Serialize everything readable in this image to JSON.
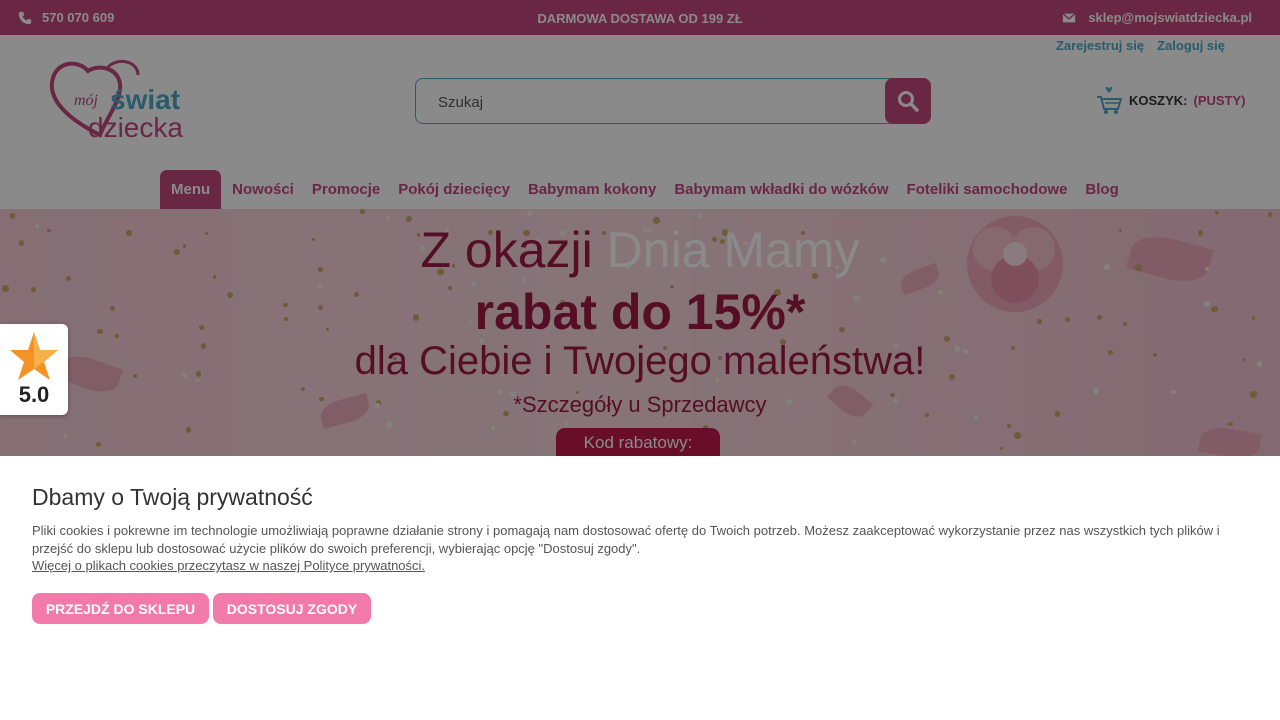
{
  "topbar": {
    "phone": "570 070 609",
    "promo": "DARMOWA DOSTAWA OD 199 ZŁ",
    "email": "sklep@mojswiatdziecka.pl"
  },
  "header": {
    "register": "Zarejestruj się",
    "login": "Zaloguj się",
    "logo_text": {
      "line1": "mój",
      "line2": "świat",
      "line3": "dziecka"
    },
    "search_placeholder": "Szukaj",
    "cart_label": "KOSZYK:",
    "cart_status": "(PUSTY)"
  },
  "nav": {
    "menu": "Menu",
    "items": [
      "Nowości",
      "Promocje",
      "Pokój dziecięcy",
      "Babymam kokony",
      "Babymam wkładki do wózków",
      "Foteliki samochodowe",
      "Blog"
    ]
  },
  "banner": {
    "line1_a": "Z okazji ",
    "line1_b": "Dnia Mamy",
    "line2": "rabat do 15%*",
    "line3": "dla Ciebie i Twojego maleństwa!",
    "line4": "*Szczegóły u Sprzedawcy",
    "code_label": "Kod rabatowy:"
  },
  "rating": {
    "value": "5.0"
  },
  "cookie": {
    "title": "Dbamy o Twoją prywatność",
    "text": "Pliki cookies i pokrewne im technologie umożliwiają poprawne działanie strony i pomagają nam dostosować ofertę do Twoich potrzeb. Możesz zaakceptować wykorzystanie przez nas wszystkich tych plików i przejść do sklepu lub dostosować użycie plików do swoich preferencji, wybierając opcję \"Dostosuj zgody\".",
    "link": "Więcej o plikach cookies przeczytasz w naszej Polityce prywatności.",
    "btn_accept": "PRZEJDŹ DO SKLEPU",
    "btn_customize": "DOSTOSUJ ZGODY"
  },
  "colors": {
    "brand_pink": "#c5487e",
    "accent_blue": "#4ea9c7",
    "button_pink": "#f17aaa",
    "banner_red": "#9e1b45"
  },
  "icons": [
    "phone-icon",
    "mail-icon",
    "search-icon",
    "cart-icon",
    "star-icon"
  ]
}
